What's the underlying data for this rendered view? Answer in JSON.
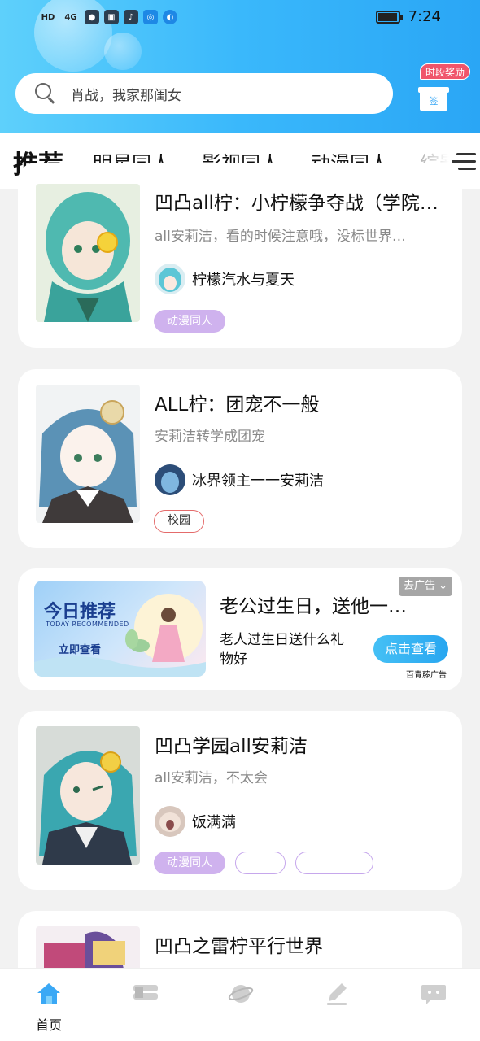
{
  "status_bar": {
    "network": "HD",
    "signal": "4G",
    "time": "7:24",
    "battery_level": 0.9
  },
  "search": {
    "placeholder": "肖战，我家那闺女"
  },
  "reward": {
    "badge": "时段奖励",
    "icon_label": "签"
  },
  "tabs": [
    {
      "label": "推荐",
      "active": true
    },
    {
      "label": "明星同人"
    },
    {
      "label": "影视同人"
    },
    {
      "label": "动漫同人"
    },
    {
      "label": "综影"
    }
  ],
  "cards": [
    {
      "title": "凹凸all柠：小柠檬争夺战（学院…",
      "desc": "all安莉洁，看的时候注意哦，没标世界…",
      "author": "柠檬汽水与夏天",
      "tags": [
        "动漫同人"
      ]
    },
    {
      "title": "ALL柠：团宠不一般",
      "desc": "安莉洁转学成团宠",
      "author": "冰界领主一一安莉洁",
      "tags": [
        "校园"
      ]
    },
    {
      "title": "凹凸学园all安莉洁",
      "desc": "all安莉洁，不太会",
      "author": "饭满满",
      "tags": [
        "动漫同人",
        "",
        ""
      ]
    },
    {
      "title": "凹凸之雷柠平行世界"
    }
  ],
  "ad": {
    "banner_title": "今日推荐",
    "banner_subtitle": "TODAY RECOMMENDED",
    "banner_button": "立即查看",
    "title": "老公过生日，送他一…",
    "desc": "老人过生日送什么礼物好",
    "close_label": "去广告",
    "cta": "点击查看",
    "source": "百青藤广告"
  },
  "bottom_nav": [
    {
      "label": "首页",
      "icon": "home-icon",
      "active": true
    },
    {
      "label": "",
      "icon": "library-icon"
    },
    {
      "label": "",
      "icon": "planet-icon"
    },
    {
      "label": "",
      "icon": "write-icon"
    },
    {
      "label": "",
      "icon": "message-icon"
    }
  ],
  "colors": {
    "header_start": "#5ed0fb",
    "header_end": "#2aa6f5",
    "accent_purple": "#cfb2ee",
    "home_active": "#3aa8f5"
  }
}
